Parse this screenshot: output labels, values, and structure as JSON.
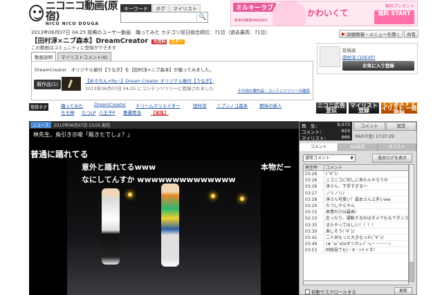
{
  "logo": {
    "text": "ニコニコ動画(原宿)",
    "sub": "NICO NICO DOUGA"
  },
  "search": {
    "tabs": [
      "キーワード",
      "タグ",
      "マイリスト"
    ],
    "placeholder": "",
    "button": "🔍"
  },
  "ad": {
    "title": "ミルキーラブ",
    "sub": "新世代簡単MMORPG",
    "kawa": "かわいくて",
    "top": "無料プレゼント",
    "start": "無料 START"
  },
  "header": {
    "meta": "2013年06月07日 04:25 投稿のユーザー動画　踊ってみた カテゴリ前日総合順位：71位（過去最高：71位）",
    "title": "【田村淳×ニブ森本】DreamCreator",
    "title_badge": "大百科",
    "title_star": "スター",
    "note": "この動画はコミュニティに登録ができます",
    "detail_btn": "詳細情報・メニューを開く",
    "share_btn": "共有",
    "desc_tabs": [
      "動画説明",
      "マイリストコメント(6)"
    ]
  },
  "description": {
    "text": "DreamCreator　オリジナル振付【うなぎ】を【田村淳×ニブ森本】が踊ってみました。",
    "tree_btn": "親作品(1)",
    "tree_link": "【めろちん×Ry☆】Dream Creator オリジナル振付【うなぎ】",
    "tree_date": "2013年06月07日 04:25 にコンテンツツリーに登録されました",
    "tree_more": "その他の親作品・コンテンツツリーの確認"
  },
  "uploader": {
    "label": "投稿者",
    "name": "田村淳 (10EXP)",
    "fav": "お気に入り登録"
  },
  "tags": {
    "label": "登録タグ",
    "row1": [
      "DreamCreator",
      "ドリームクリエイター",
      "田村淳",
      "ニブンノゴ森本",
      "期待の新人"
    ],
    "row2": [
      "踊ってみた",
      "DreamCreator",
      "モモ神",
      "たつLP",
      "八王子P",
      "ニコニコ動画踊り手",
      "ニ表示"
    ],
    "row3": [
      "モモ神",
      "たつLP",
      "八王子P",
      "曹遷貴浩",
      "【編集】"
    ]
  },
  "promo": {
    "senden": "ニコニ広告 宣伝",
    "mylist": "マイリスト登録",
    "tori": "とりあえずマイリスト 一発登録"
  },
  "player": {
    "news": "ニュース",
    "date": "2013年06月07日 13:05 配信",
    "ticker": "林先生、鳥引き示唆「殿きたでしょ？」",
    "comments": [
      "普通に踊れてる",
      "意外と踊れてるwww",
      "本物だー",
      "なにしてんすか wwwwwwwwwwwwww"
    ]
  },
  "stats": {
    "views_label": "再　生：",
    "views": "9,073",
    "comments_label": "コメント：",
    "comments": "623",
    "mylist_label": "マイリスト：",
    "mylist": "666",
    "date": "06/07(金) 17:07:29"
  },
  "side_buttons": {
    "comment": "コメント",
    "settings": "設定"
  },
  "comment_tabs": [
    "コメント",
    "NG設定",
    "オススメ"
  ],
  "comment_panel": {
    "select": "通常コメント",
    "past_log": "過去ログを表示",
    "col_time": "再生時",
    "col_text": "コメント",
    "rows": [
      {
        "t": "03:28",
        "c": "(´∀`)ﾉ"
      },
      {
        "t": "03:26",
        "c": "ニコニコに何しに来たんやろうか"
      },
      {
        "t": "03:26",
        "c": "淳さん、下手すぎる〜"
      },
      {
        "t": "03:27",
        "c": "ノリノリ♪"
      },
      {
        "t": "03:28",
        "c": "淳さん可愛い！森本さん上手いww"
      },
      {
        "t": "03:29",
        "c": "たつしやらやん"
      },
      {
        "t": "03:15",
        "c": "表情だけは最高！"
      },
      {
        "t": "02:10",
        "c": "走ったり、運動するのはダメでもなでダンスは"
      },
      {
        "t": "03:35",
        "c": "またやってほしい！！！！"
      },
      {
        "t": "03:39",
        "c": "楽しそう(´∀`)♪"
      },
      {
        "t": "03:42",
        "c": "二人共もっと大きなった(´∀`)♪"
      },
      {
        "t": "03:49",
        "c": "(★´ｗ`σ)σオツカレﾃﾞｰﾑ・･･････☆"
      },
      {
        "t": "03:53",
        "c": "同田見ても(・∀・)イイネ！"
      }
    ],
    "autoscroll": "自動でスクロールする",
    "refresh": "更新"
  }
}
